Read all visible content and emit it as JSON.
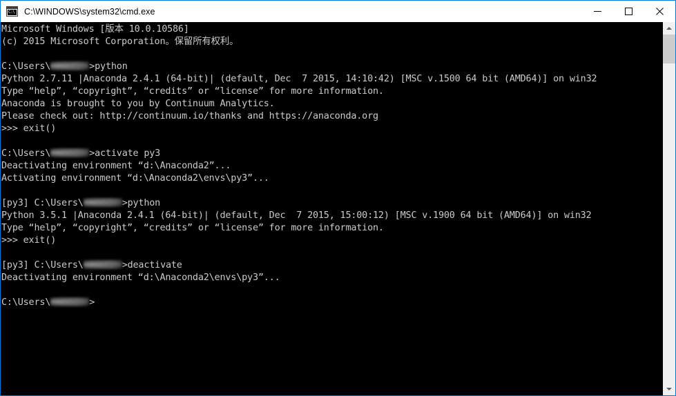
{
  "window": {
    "title": "C:\\WINDOWS\\system32\\cmd.exe",
    "icon": "cmd-icon",
    "icon_glyph": "C:\\",
    "accent_border_color": "#0078d7",
    "titlebar_bg": "#ffffff",
    "console_bg": "#000000",
    "console_fg": "#cccccc",
    "controls": {
      "minimize_label": "Minimize",
      "maximize_label": "Maximize",
      "close_label": "Close"
    }
  },
  "scrollbar": {
    "up_arrow_label": "Scroll up",
    "down_arrow_label": "Scroll down",
    "thumb_label": "Scroll thumb"
  },
  "console": {
    "lines": [
      {
        "id": "l01",
        "text": "Microsoft Windows [版本 10.0.10586]"
      },
      {
        "id": "l02",
        "text": "(c) 2015 Microsoft Corporation。保留所有权利。"
      },
      {
        "id": "l03",
        "text": ""
      },
      {
        "id": "l04",
        "pre": "C:\\Users\\",
        "redacted": true,
        "post": ">python"
      },
      {
        "id": "l05",
        "text": "Python 2.7.11 |Anaconda 2.4.1 (64-bit)| (default, Dec  7 2015, 14:10:42) [MSC v.1500 64 bit (AMD64)] on win32"
      },
      {
        "id": "l06",
        "text": "Type “help”, “copyright”, “credits” or “license” for more information."
      },
      {
        "id": "l07",
        "text": "Anaconda is brought to you by Continuum Analytics."
      },
      {
        "id": "l08",
        "text": "Please check out: http://continuum.io/thanks and https://anaconda.org"
      },
      {
        "id": "l09",
        "text": ">>> exit()"
      },
      {
        "id": "l10",
        "text": ""
      },
      {
        "id": "l11",
        "pre": "C:\\Users\\",
        "redacted": true,
        "post": ">activate py3"
      },
      {
        "id": "l12",
        "text": "Deactivating environment “d:\\Anaconda2”..."
      },
      {
        "id": "l13",
        "text": "Activating environment “d:\\Anaconda2\\envs\\py3”..."
      },
      {
        "id": "l14",
        "text": ""
      },
      {
        "id": "l15",
        "pre": "[py3] C:\\Users\\",
        "redacted": true,
        "post": ">python"
      },
      {
        "id": "l16",
        "text": "Python 3.5.1 |Anaconda 2.4.1 (64-bit)| (default, Dec  7 2015, 15:00:12) [MSC v.1900 64 bit (AMD64)] on win32"
      },
      {
        "id": "l17",
        "text": "Type “help”, “copyright”, “credits” or “license” for more information."
      },
      {
        "id": "l18",
        "text": ">>> exit()"
      },
      {
        "id": "l19",
        "text": ""
      },
      {
        "id": "l20",
        "pre": "[py3] C:\\Users\\",
        "redacted": true,
        "post": ">deactivate"
      },
      {
        "id": "l21",
        "text": "Deactivating environment “d:\\Anaconda2\\envs\\py3”..."
      },
      {
        "id": "l22",
        "text": ""
      },
      {
        "id": "l23",
        "pre": "C:\\Users\\",
        "redacted": true,
        "post": ">"
      }
    ]
  }
}
